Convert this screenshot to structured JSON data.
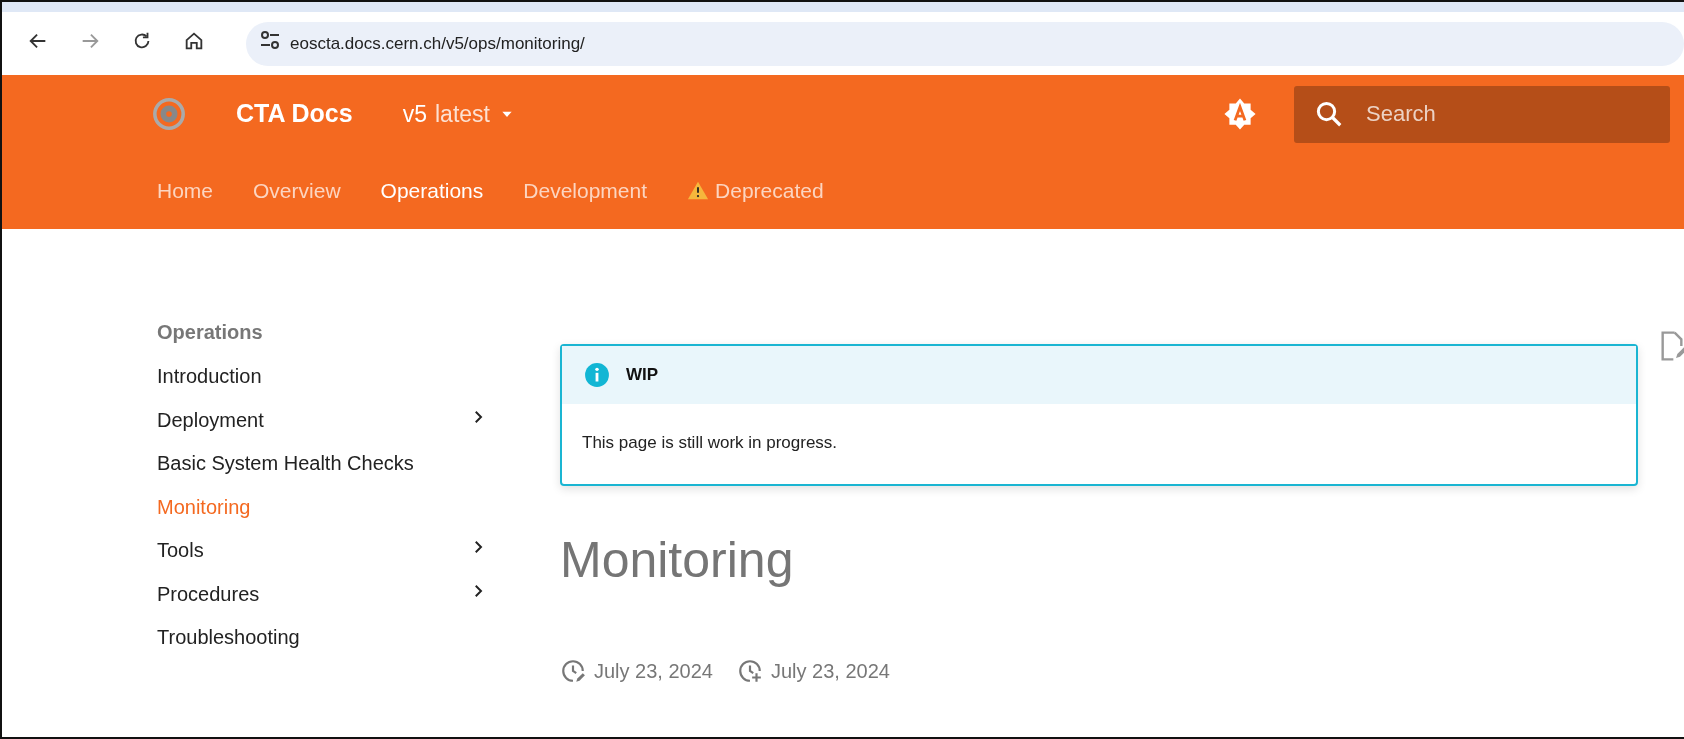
{
  "browser": {
    "url": "eoscta.docs.cern.ch/v5/ops/monitoring/"
  },
  "header": {
    "title": "CTA Docs",
    "version": "v5",
    "version_alias": "latest",
    "search": {
      "placeholder": "Search"
    }
  },
  "tabs": [
    {
      "label": "Home",
      "selected": false,
      "kind": "plain"
    },
    {
      "label": "Overview",
      "selected": false,
      "kind": "plain"
    },
    {
      "label": "Operations",
      "selected": true,
      "kind": "plain"
    },
    {
      "label": "Development",
      "selected": false,
      "kind": "plain"
    },
    {
      "label": "Deprecated",
      "selected": false,
      "kind": "warning"
    }
  ],
  "sidebar": {
    "heading": "Operations",
    "items": [
      {
        "label": "Introduction",
        "selected": false,
        "expandable": false
      },
      {
        "label": "Deployment",
        "selected": false,
        "expandable": true
      },
      {
        "label": "Basic System Health Checks",
        "selected": false,
        "expandable": false
      },
      {
        "label": "Monitoring",
        "selected": true,
        "expandable": false
      },
      {
        "label": "Tools",
        "selected": false,
        "expandable": true
      },
      {
        "label": "Procedures",
        "selected": false,
        "expandable": true
      },
      {
        "label": "Troubleshooting",
        "selected": false,
        "expandable": false
      }
    ]
  },
  "admonition": {
    "title": "WIP",
    "body": "This page is still work in progress."
  },
  "page": {
    "title": "Monitoring",
    "dates": [
      {
        "kind": "updated",
        "text": "July 23, 2024"
      },
      {
        "kind": "created",
        "text": "July 23, 2024"
      }
    ]
  }
}
